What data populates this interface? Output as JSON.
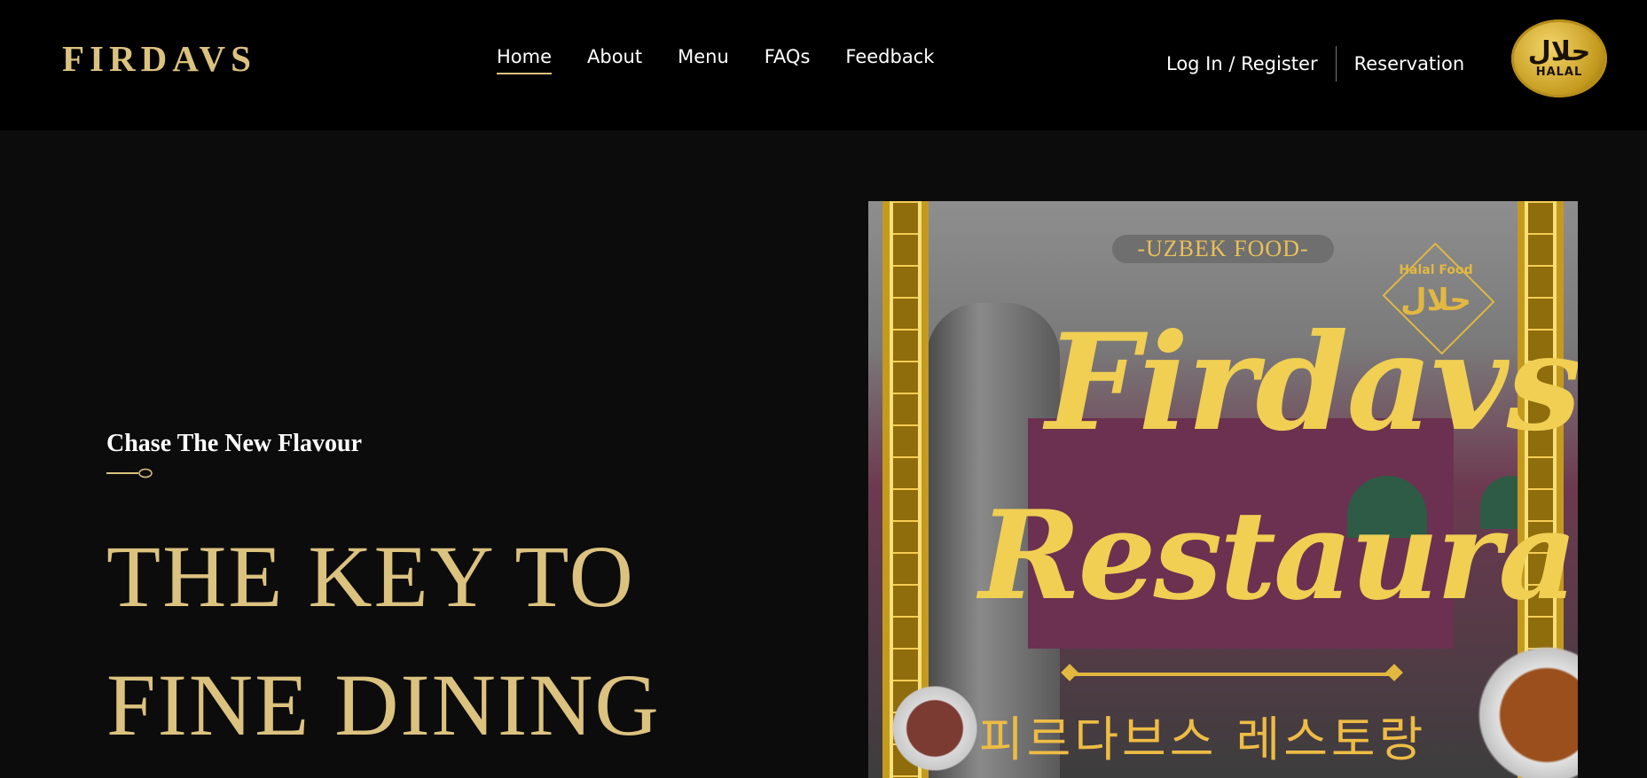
{
  "header": {
    "brand": "FIRDAVS",
    "nav": [
      "Home",
      "About",
      "Menu",
      "FAQs",
      "Feedback"
    ],
    "active_nav": "Home",
    "login_label": "Log In / Register",
    "reservation_label": "Reservation",
    "halal_badge": {
      "arabic": "حلال",
      "label": "HALAL"
    }
  },
  "hero": {
    "tagline": "Chase The New Flavour",
    "headline_line1": "THE KEY TO",
    "headline_line2": "FINE DINING",
    "poster": {
      "tag": "-UZBEK FOOD-",
      "halal_food_label": "Halal Food",
      "halal_food_arabic": "حلال",
      "title_line1": "Firdavs",
      "title_line2": "Restaurant",
      "korean_title": "피르다브스 레스토랑"
    }
  },
  "colors": {
    "gold": "#dcc27f",
    "background": "#0c0c0d",
    "header": "#000000"
  }
}
